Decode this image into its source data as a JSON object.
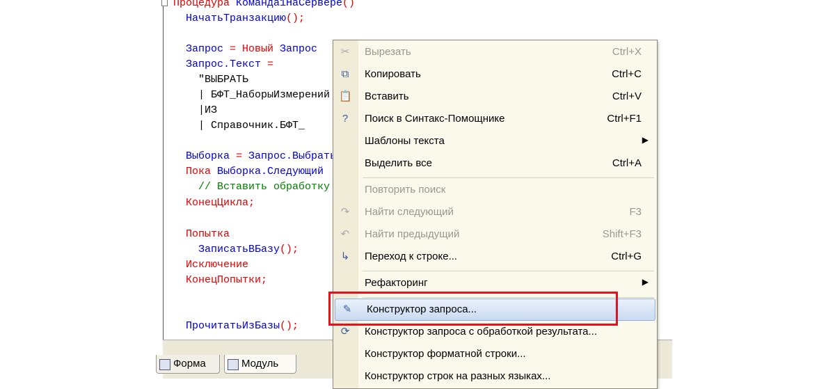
{
  "code": [
    [
      [
        "kw",
        "Процедура "
      ],
      [
        "id",
        "Команда1НаСервере"
      ],
      [
        "op",
        "()"
      ]
    ],
    [
      [
        "id",
        "  НачатьТранзакцию"
      ],
      [
        "op",
        "();"
      ]
    ],
    [],
    [
      [
        "id",
        "  Запрос "
      ],
      [
        "op",
        "= "
      ],
      [
        "kw",
        "Новый "
      ],
      [
        "id",
        "Запрос"
      ]
    ],
    [
      [
        "id",
        "  Запрос.Текст "
      ],
      [
        "op",
        "="
      ]
    ],
    [
      [
        "tx",
        "    \"ВЫБРАТЬ"
      ]
    ],
    [
      [
        "tx",
        "    | БФТ_НаборыИзмерений"
      ]
    ],
    [
      [
        "tx",
        "    |ИЗ"
      ]
    ],
    [
      [
        "tx",
        "    | Справочник.БФТ_"
      ]
    ],
    [],
    [
      [
        "id",
        "  Выборка "
      ],
      [
        "op",
        "= "
      ],
      [
        "id",
        "Запрос.Выбрать"
      ]
    ],
    [
      [
        "kw",
        "  Пока "
      ],
      [
        "id",
        "Выборка.Следующий"
      ]
    ],
    [
      [
        "cm",
        "    // Вставить обработку"
      ]
    ],
    [
      [
        "kw",
        "  КонецЦикла;"
      ]
    ],
    [],
    [
      [
        "kw",
        "  Попытка"
      ]
    ],
    [
      [
        "id",
        "    ЗаписатьВБазу"
      ],
      [
        "op",
        "();"
      ]
    ],
    [
      [
        "kw",
        "  Исключение"
      ]
    ],
    [
      [
        "kw",
        "  КонецПопытки;"
      ]
    ],
    [],
    [],
    [
      [
        "id",
        "  ПрочитатьИзБазы"
      ],
      [
        "op",
        "();"
      ]
    ]
  ],
  "tabs": [
    {
      "label": "Форма"
    },
    {
      "label": "Модуль"
    }
  ],
  "menu": [
    {
      "label": "Вырезать",
      "shortcut": "Ctrl+X",
      "icon": "scissors-icon",
      "glyph": "✂",
      "disabled": true
    },
    {
      "label": "Копировать",
      "shortcut": "Ctrl+C",
      "icon": "copy-icon",
      "glyph": "⧉"
    },
    {
      "label": "Вставить",
      "shortcut": "Ctrl+V",
      "icon": "paste-icon",
      "glyph": "📋"
    },
    {
      "label": "Поиск в Синтакс-Помощнике",
      "shortcut": "Ctrl+F1",
      "icon": "search-help-icon",
      "glyph": "?"
    },
    {
      "label": "Шаблоны текста",
      "submenu": true
    },
    {
      "label": "Выделить все",
      "shortcut": "Ctrl+A",
      "sep_after": true
    },
    {
      "label": "Повторить поиск",
      "disabled": true
    },
    {
      "label": "Найти следующий",
      "shortcut": "F3",
      "icon": "find-next-icon",
      "glyph": "↷",
      "disabled": true
    },
    {
      "label": "Найти предыдущий",
      "shortcut": "Shift+F3",
      "icon": "find-prev-icon",
      "glyph": "↶",
      "disabled": true
    },
    {
      "label": "Переход к строке...",
      "shortcut": "Ctrl+G",
      "icon": "goto-line-icon",
      "glyph": "↳",
      "sep_after": true
    },
    {
      "label": "Рефакторинг",
      "submenu": true,
      "sep_after": true
    },
    {
      "label": "Конструктор запроса...",
      "icon": "query-builder-icon",
      "glyph": "✎",
      "highlighted": true
    },
    {
      "label": "Конструктор запроса с обработкой результата...",
      "icon": "query-builder-result-icon",
      "glyph": "⟳"
    },
    {
      "label": "Конструктор форматной строки..."
    },
    {
      "label": "Конструктор строк на разных языках..."
    }
  ]
}
